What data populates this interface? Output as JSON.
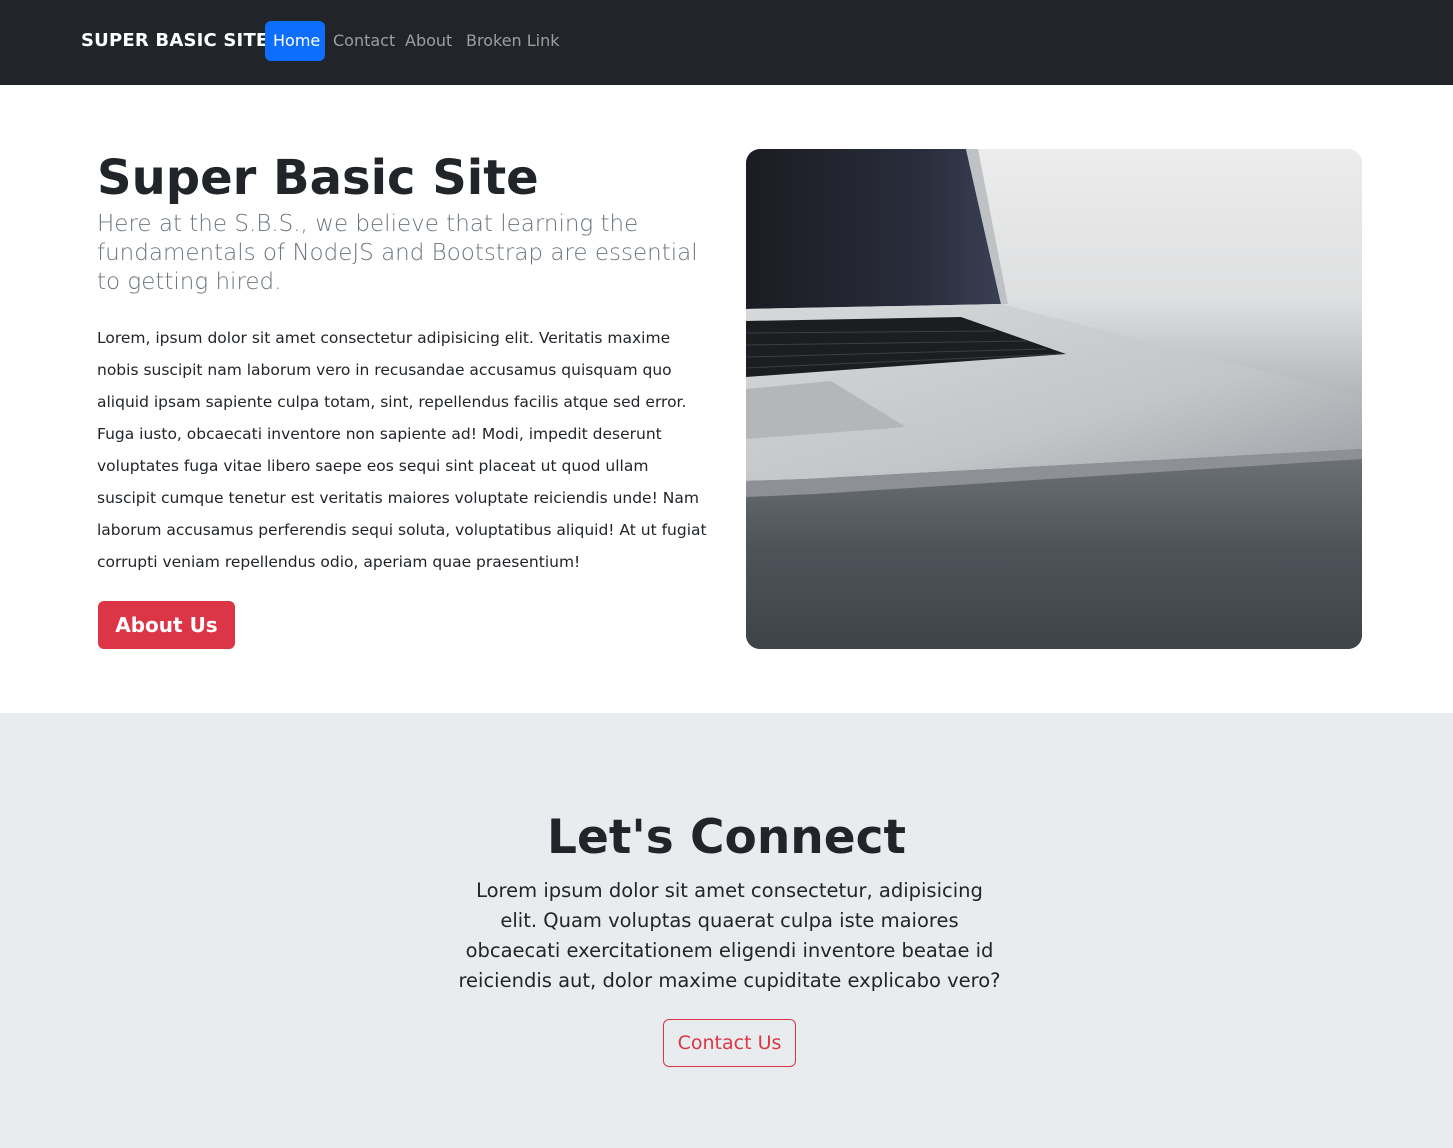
{
  "navbar": {
    "brand": "SUPER BASIC SITE",
    "items": [
      {
        "label": "Home",
        "active": true
      },
      {
        "label": "Contact",
        "active": false
      },
      {
        "label": "About",
        "active": false
      },
      {
        "label": "Broken Link",
        "active": false
      }
    ],
    "active_color": "#0d6efd",
    "background": "#212529"
  },
  "hero": {
    "title": "Super Basic Site",
    "lead": "Here at the S.B.S., we believe that learning the fundamentals of NodeJS and Bootstrap are essential to getting hired.",
    "body": "Lorem, ipsum dolor sit amet consectetur adipisicing elit. Veritatis maxime nobis suscipit nam laborum vero in recusandae accusamus quisquam quo aliquid ipsam sapiente culpa totam, sint, repellendus facilis atque sed error. Fuga iusto, obcaecati inventore non sapiente ad! Modi, impedit deserunt voluptates fuga vitae libero saepe eos sequi sint placeat ut quod ullam suscipit cumque tenetur est veritatis maiores voluptate reiciendis unde! Nam laborum accusamus perferendis sequi soluta, voluptatibus aliquid! At ut fugiat corrupti veniam repellendus odio, aperiam quae praesentium!",
    "button_label": "About Us",
    "button_color": "#dc3545",
    "image_icon": "laptop-photo"
  },
  "connect": {
    "title": "Let's Connect",
    "text": "Lorem ipsum dolor sit amet consectetur, adipisicing elit. Quam voluptas quaerat culpa iste maiores obcaecati exercitationem eligendi inventore beatae id reiciendis aut, dolor maxime cupiditate explicabo vero?",
    "button_label": "Contact Us",
    "background": "#e9ecef"
  }
}
